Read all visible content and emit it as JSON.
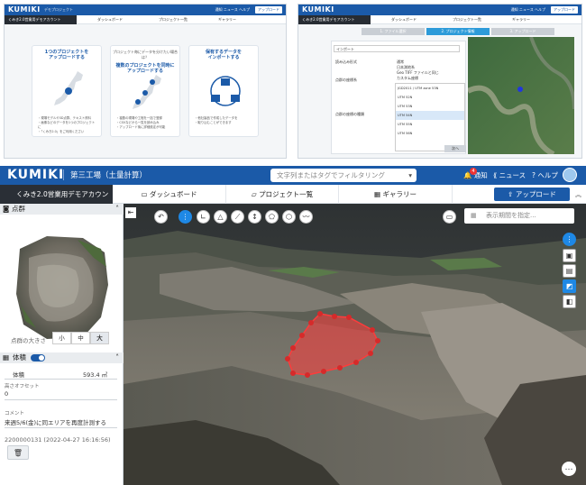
{
  "panel1": {
    "logo": "KUMIKI",
    "sub": "デモプロジェクト",
    "header_links": "通知 ニュース ヘルプ",
    "upload": "アップロード",
    "account": "くみき2.0営業用デモアカウント",
    "nav": [
      "ダッシュボード",
      "プロジェクト一覧",
      "ギャラリー"
    ],
    "cards": [
      {
        "top": "",
        "title": "1つのプロジェクトを\nアップロードする",
        "desc": "・現場モデルや3D点群、テキスト資料\n・画像などのデータを1つのプロジェクトに\n・「くみき2.0」をご利用ください"
      },
      {
        "top": "プロジェクト毎にデータを分けたい場合は？",
        "title": "複数のプロジェクトを同時に\nアップロードする",
        "desc": "・複数の現場や工程を一括で登録\n・CSVなどから一覧を読み込み\n・アップロード後に詳細設定が可能"
      },
      {
        "top": "",
        "title": "保有するデータを\nインポートする",
        "desc": "・他社製品で作成したデータを\n・取り込むことができます"
      }
    ]
  },
  "panel2": {
    "logo": "KUMIKI",
    "sub": "くみき2.0営業用デモアカウント",
    "steps": [
      "1. ファイル選択",
      "2. プロジェクト情報",
      "3. アップロード"
    ],
    "form_title": "インポート",
    "rows": [
      "読み込み形式",
      "点群の座標系",
      "点群の座標の種類"
    ],
    "radios": [
      "通常",
      "日本測地系",
      "Geo TIFF ファイルと同じ",
      "カスタム座標"
    ],
    "list": [
      "JGD2011 / UTM zone 53N",
      "UTM 52N",
      "UTM 53N",
      "UTM 54N",
      "UTM 55N",
      "UTM 56N"
    ],
    "next": "次へ"
  },
  "app": {
    "logo": "KUMIKI",
    "project": "第三工場（土量計算）",
    "search_placeholder": "文字列またはタグでフィルタリング",
    "notify": "通知",
    "notify_count": "4",
    "news": "ニュース",
    "help": "ヘルプ",
    "account": "くみき2.0営業用デモアカウント",
    "tabs": [
      "ダッシュボード",
      "プロジェクト一覧",
      "ギャラリー"
    ],
    "upload": "アップロード",
    "pointcloud_head": "点群",
    "point_size_label": "点群の大きさ",
    "sizes": [
      "小",
      "中",
      "大"
    ],
    "volume_head": "体積",
    "volume_label": "体積",
    "volume_value": "593.4 ㎥",
    "height_offset_label": "高さオフセット",
    "height_offset_value": "0",
    "comment_label": "コメント",
    "comment_value": "来週5/6(金)に同エリアを再度計測する",
    "record": "2200000131 (2022-04-27 16:16:56)",
    "date_placeholder": "表示期間を指定..."
  },
  "colors": {
    "brand": "#1b5aa8",
    "selection": "#ff3b3b",
    "dark": "#2a2f36"
  },
  "icons": [
    "bell-icon",
    "news-icon",
    "help-icon",
    "upload-icon",
    "camera-icon",
    "trash-icon",
    "calendar-icon",
    "grid-icon",
    "folder-icon",
    "monitor-icon"
  ]
}
